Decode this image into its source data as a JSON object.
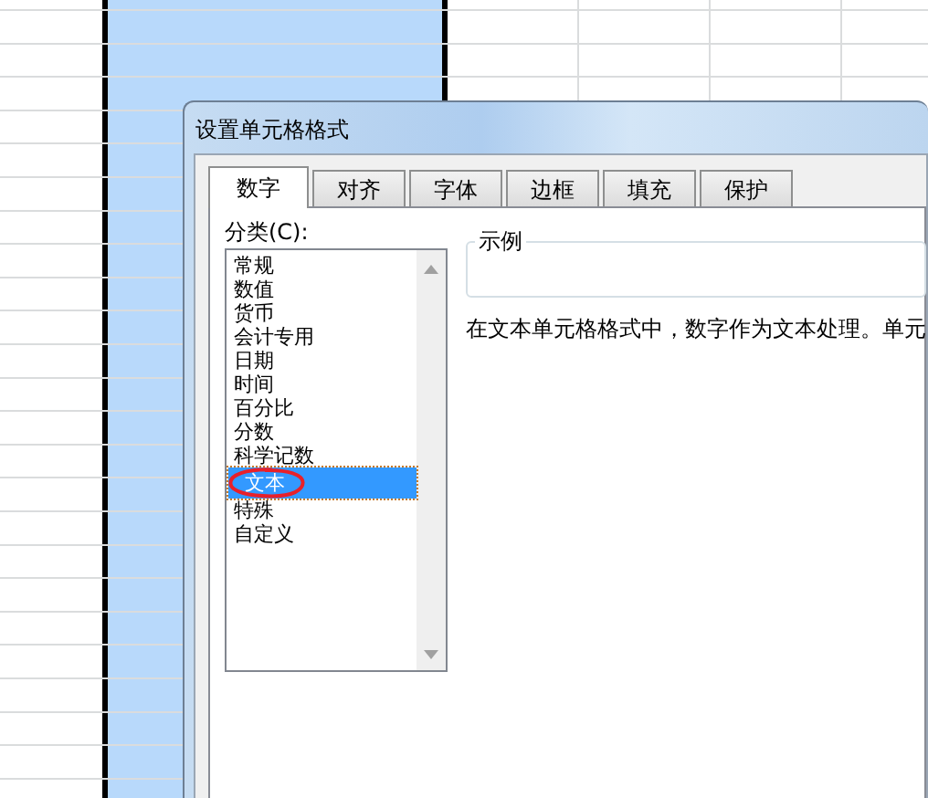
{
  "dialog": {
    "title": "设置单元格格式",
    "tabs": [
      {
        "label": "数字",
        "selected": true
      },
      {
        "label": "对齐",
        "selected": false
      },
      {
        "label": "字体",
        "selected": false
      },
      {
        "label": "边框",
        "selected": false
      },
      {
        "label": "填充",
        "selected": false
      },
      {
        "label": "保护",
        "selected": false
      }
    ],
    "category_label": "分类(C):",
    "categories": [
      {
        "label": "常规",
        "selected": false,
        "circled": false
      },
      {
        "label": "数值",
        "selected": false,
        "circled": false
      },
      {
        "label": "货币",
        "selected": false,
        "circled": false
      },
      {
        "label": "会计专用",
        "selected": false,
        "circled": false
      },
      {
        "label": "日期",
        "selected": false,
        "circled": false
      },
      {
        "label": "时间",
        "selected": false,
        "circled": false
      },
      {
        "label": "百分比",
        "selected": false,
        "circled": false
      },
      {
        "label": "分数",
        "selected": false,
        "circled": false
      },
      {
        "label": "科学记数",
        "selected": false,
        "circled": false
      },
      {
        "label": "文本",
        "selected": true,
        "circled": true
      },
      {
        "label": "特殊",
        "selected": false,
        "circled": false
      },
      {
        "label": "自定义",
        "selected": false,
        "circled": false
      }
    ],
    "sample_label": "示例",
    "description": "在文本单元格格式中，数字作为文本处理。单元"
  }
}
